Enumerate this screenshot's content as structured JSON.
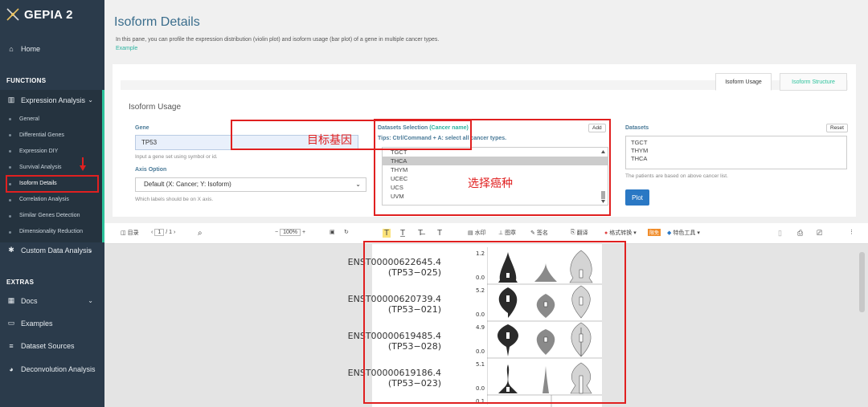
{
  "app": {
    "name": "GEPIA 2"
  },
  "sidebar": {
    "home": "Home",
    "functions_header": "FUNCTIONS",
    "expression_analysis": "Expression Analysis",
    "sub_items": [
      "General",
      "Differential Genes",
      "Expression DIY",
      "Survival Analysis",
      "Isoform Details",
      "Correlation Analysis",
      "Similar Genes Detection",
      "Dimensionality Reduction"
    ],
    "custom_data": "Custom Data Analysis",
    "extras_header": "EXTRAS",
    "docs": "Docs",
    "examples": "Examples",
    "dataset_sources": "Dataset Sources",
    "deconvolution": "Deconvolution Analysis"
  },
  "page": {
    "title": "Isoform Details",
    "description": "In this pane, you can profile the expression distribution (violin plot) and isoform usage (bar plot) of a gene in multiple cancer types.",
    "example_link": "Example"
  },
  "tabs": {
    "isoform_usage": "Isoform Usage",
    "isoform_structure": "Isoform Structure"
  },
  "form": {
    "section_title": "Isoform Usage",
    "gene_label": "Gene",
    "gene_value": "TP53",
    "gene_hint": "Input a gene set using symbol or id.",
    "axis_label": "Axis Option",
    "axis_value": "Default (X: Cancer; Y: Isoform)",
    "axis_hint": "Which labels should be on X axis.",
    "ds_label": "Datasets Selection",
    "ds_label_paren": "(Cancer name)",
    "ds_tips": "Tips: Ctrl/Command + A: select all cancer types.",
    "add_button": "Add",
    "ds_list": [
      "TGCT",
      "THCA",
      "THYM",
      "UCEC",
      "UCS",
      "UVM"
    ],
    "ds_selected": "THCA",
    "datasets_label": "Datasets",
    "reset_button": "Reset",
    "datasets_value": [
      "TGCT",
      "THYM",
      "THCA"
    ],
    "patients_note": "The patients are based on above cancer list.",
    "plot_button": "Plot"
  },
  "annotations": {
    "gene": "目标基因",
    "cancer": "选择癌种"
  },
  "toolbar": {
    "toc": "目录",
    "page_current": "1",
    "page_total": "/ 1",
    "zoom": "100%",
    "watermark": "水印",
    "stamp": "图章",
    "sign": "签名",
    "translate": "翻译",
    "format": "格式转换",
    "features": "特色工具",
    "badge": "限免"
  },
  "plot": {
    "rows": [
      {
        "id": "ENST00000622645.4",
        "name": "(TP53−025)",
        "ymax": "1.2",
        "ymin": "0.0"
      },
      {
        "id": "ENST00000620739.4",
        "name": "(TP53−021)",
        "ymax": "5.2",
        "ymin": "0.0"
      },
      {
        "id": "ENST00000619485.4",
        "name": "(TP53−028)",
        "ymax": "4.9",
        "ymin": "0.0"
      },
      {
        "id": "ENST00000619186.4",
        "name": "(TP53−023)",
        "ymax": "5.1",
        "ymin": "0.0"
      }
    ],
    "partial_tick": "0.1",
    "colors": {
      "dark": "#2a2a2a",
      "mid": "#8a8a8a",
      "light": "#d4d4d4"
    }
  }
}
